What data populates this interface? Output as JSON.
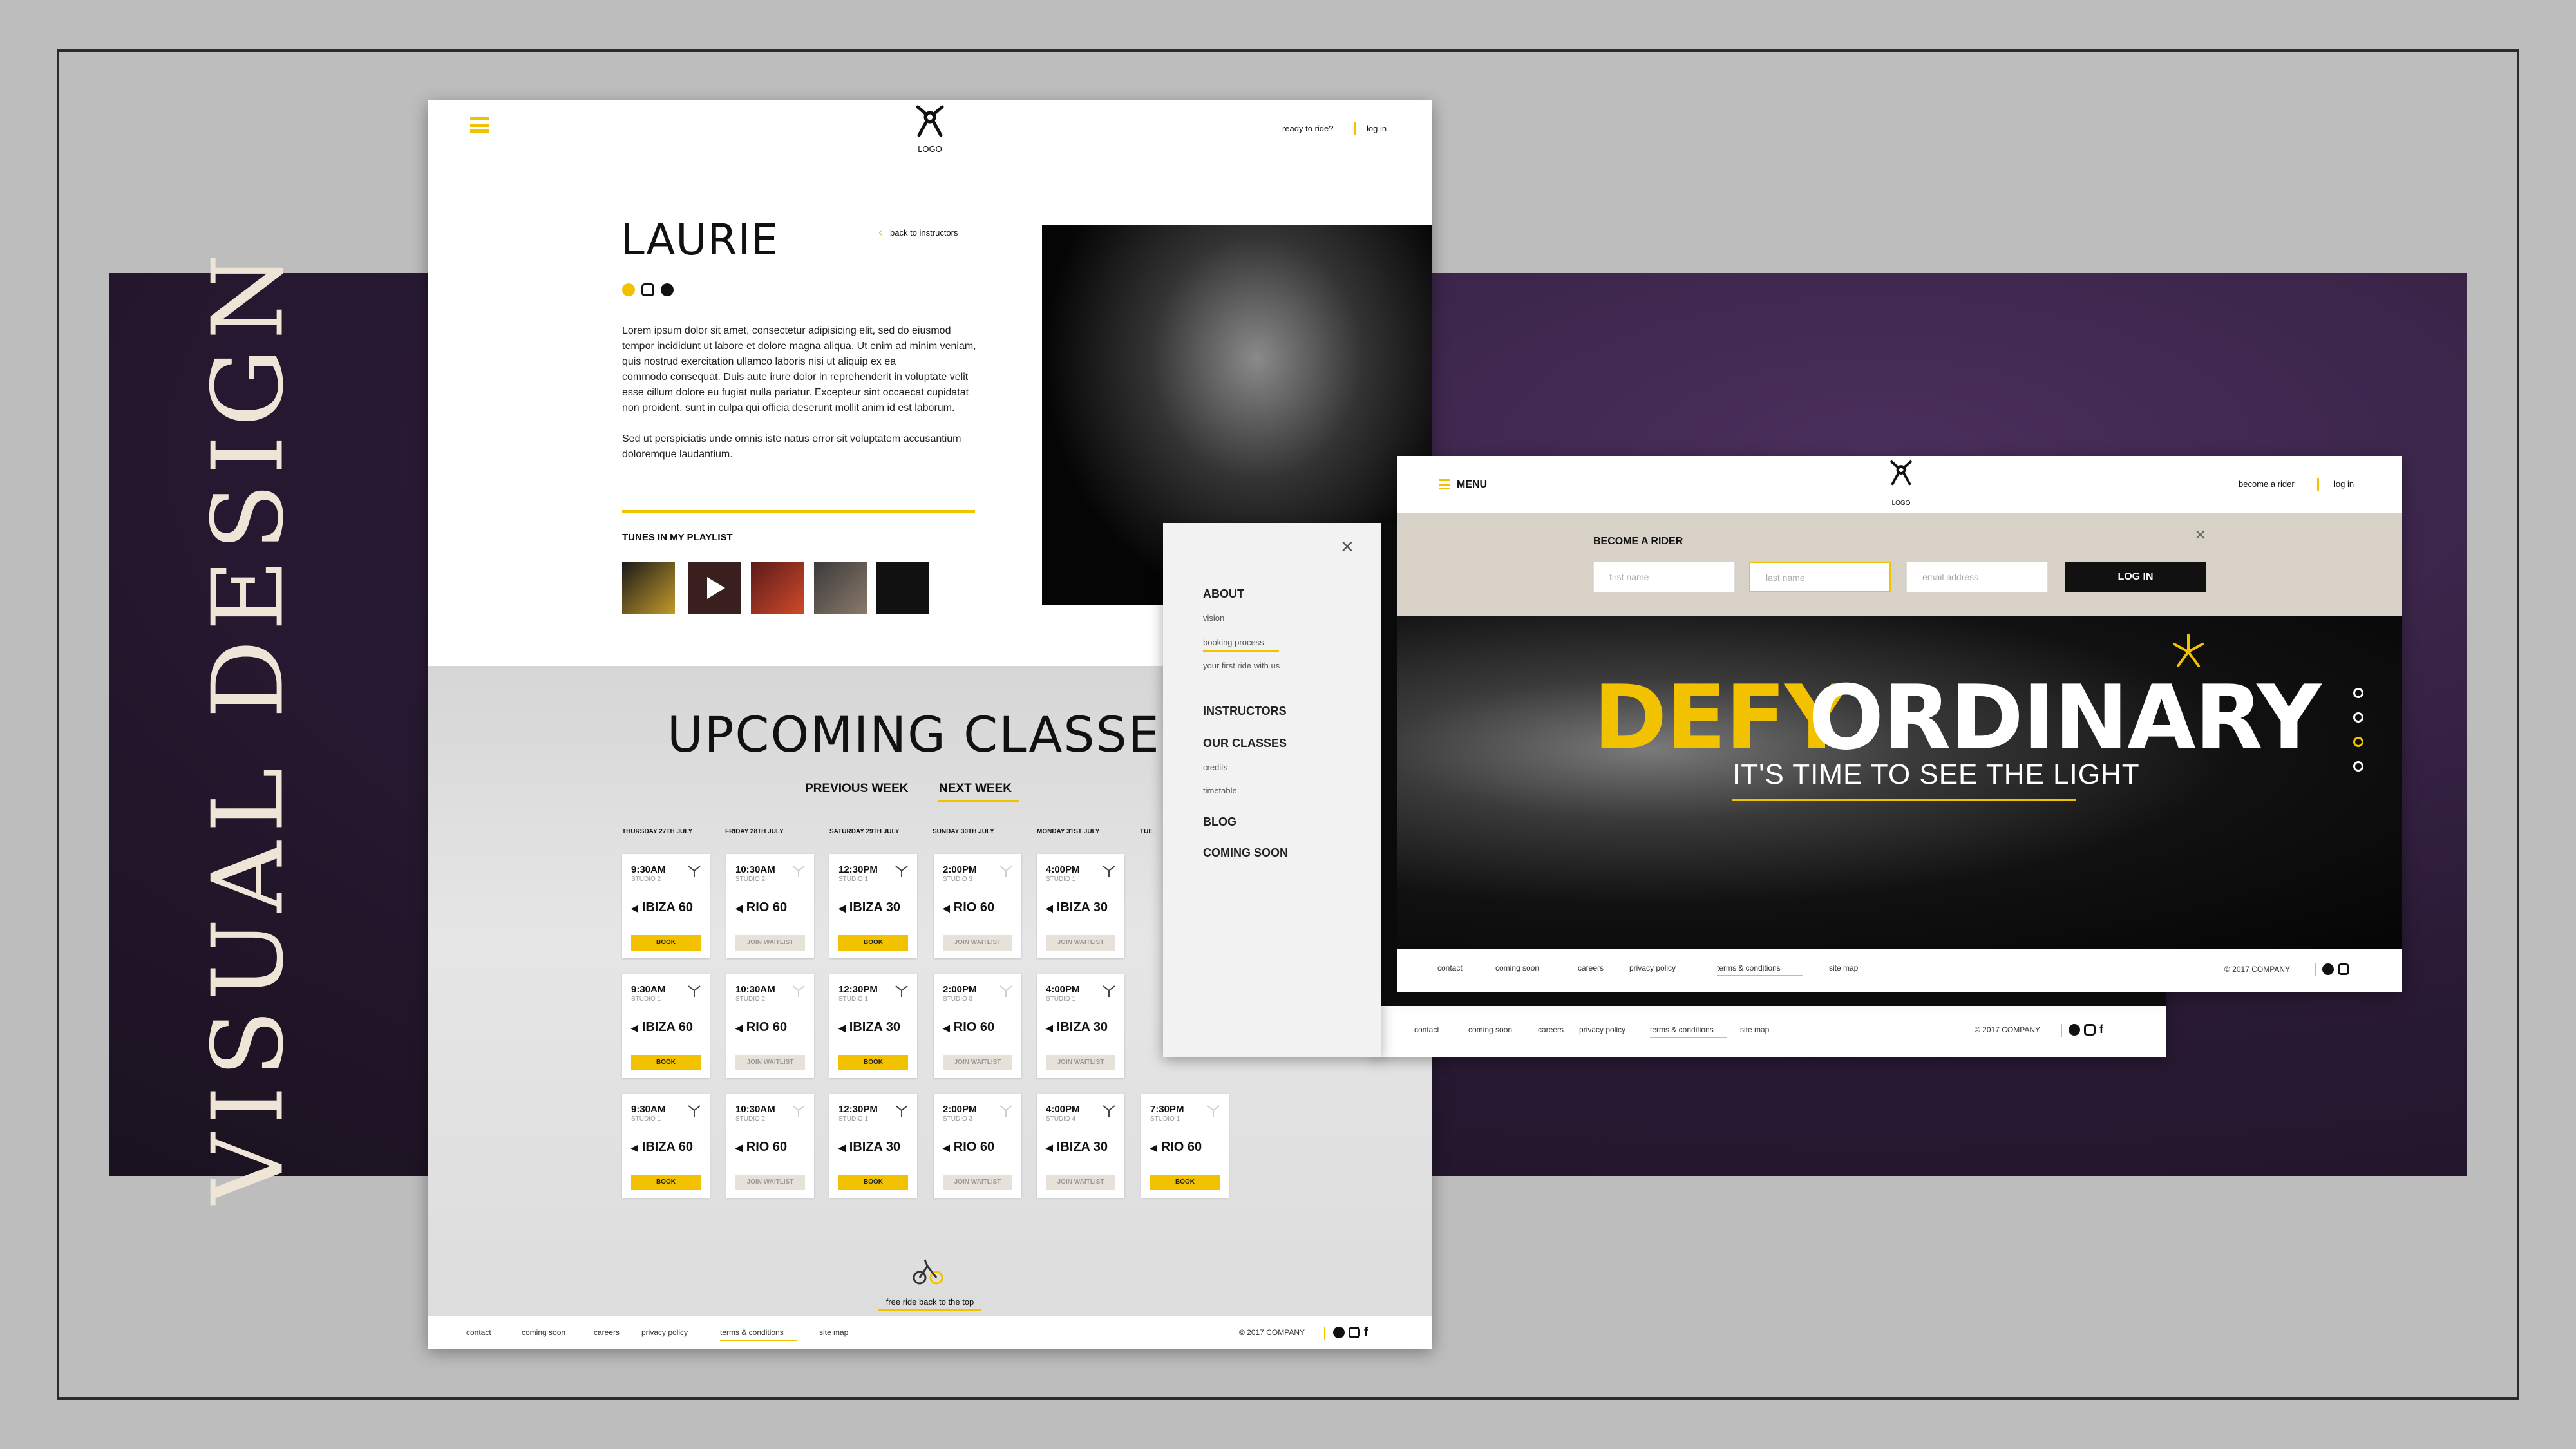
{
  "side_title": "VISUAL DESIGN",
  "colors": {
    "accent": "#f2c200",
    "band": "#2a1a35",
    "dark": "#111111"
  },
  "page1": {
    "logo_text": "LOGO",
    "ready_to_ride": "ready to ride?",
    "log_in": "log in",
    "instructor_name": "LAURIE",
    "back_link": "back to instructors",
    "bio_1": "Lorem ipsum dolor sit amet, consectetur adipisicing elit, sed do eiusmod tempor incididunt ut labore et dolore magna aliqua. Ut enim ad minim veniam, quis nostrud exercitation ullamco laboris nisi ut aliquip ex ea",
    "bio_2": "commodo consequat. Duis aute irure dolor in reprehenderit in voluptate velit esse cillum dolore eu fugiat nulla pariatur. Excepteur sint occaecat cupidatat non proident, sunt in culpa qui officia deserunt mollit anim id est laborum.",
    "bio_3": "Sed ut perspiciatis unde omnis iste natus error sit voluptatem accusantium doloremque laudantium.",
    "playlist_title": "TUNES IN MY PLAYLIST",
    "classes_title": "UPCOMING CLASSES",
    "prev_week": "PREVIOUS WEEK",
    "next_week": "NEXT WEEK",
    "days": [
      "THURSDAY 27TH JULY",
      "FRIDAY 28TH JULY",
      "SATURDAY 29TH JULY",
      "SUNDAY 30TH JULY",
      "MONDAY 31ST JULY",
      "TUE"
    ],
    "back_to_top": "free ride back to the top",
    "footer_links": [
      "contact",
      "coming soon",
      "careers",
      "privacy policy",
      "terms & conditions",
      "site map"
    ],
    "copyright": "© 2017 COMPANY"
  },
  "classes": [
    [
      {
        "time": "9:30AM",
        "studio": "STUDIO 2",
        "name": "IBIZA 60",
        "btn": "BOOK"
      },
      {
        "time": "10:30AM",
        "studio": "STUDIO 2",
        "name": "RIO 60",
        "btn": "JOIN WAITLIST"
      },
      {
        "time": "12:30PM",
        "studio": "STUDIO 1",
        "name": "IBIZA 30",
        "btn": "BOOK"
      },
      {
        "time": "2:00PM",
        "studio": "STUDIO 3",
        "name": "RIO 60",
        "btn": "JOIN WAITLIST"
      },
      {
        "time": "4:00PM",
        "studio": "STUDIO 1",
        "name": "IBIZA 30",
        "btn": "JOIN WAITLIST"
      }
    ],
    [
      {
        "time": "9:30AM",
        "studio": "STUDIO 1",
        "name": "IBIZA 60",
        "btn": "BOOK"
      },
      {
        "time": "10:30AM",
        "studio": "STUDIO 2",
        "name": "RIO 60",
        "btn": "JOIN WAITLIST"
      },
      {
        "time": "12:30PM",
        "studio": "STUDIO 1",
        "name": "IBIZA 30",
        "btn": "BOOK"
      },
      {
        "time": "2:00PM",
        "studio": "STUDIO 3",
        "name": "RIO 60",
        "btn": "JOIN WAITLIST"
      },
      {
        "time": "4:00PM",
        "studio": "STUDIO 1",
        "name": "IBIZA 30",
        "btn": "JOIN WAITLIST"
      }
    ],
    [
      {
        "time": "9:30AM",
        "studio": "STUDIO 1",
        "name": "IBIZA 60",
        "btn": "BOOK"
      },
      {
        "time": "10:30AM",
        "studio": "STUDIO 2",
        "name": "RIO 60",
        "btn": "JOIN WAITLIST"
      },
      {
        "time": "12:30PM",
        "studio": "STUDIO 1",
        "name": "IBIZA 30",
        "btn": "BOOK"
      },
      {
        "time": "2:00PM",
        "studio": "STUDIO 3",
        "name": "RIO 60",
        "btn": "JOIN WAITLIST"
      },
      {
        "time": "4:00PM",
        "studio": "STUDIO 4",
        "name": "IBIZA 30",
        "btn": "JOIN WAITLIST"
      },
      {
        "time": "7:30PM",
        "studio": "STUDIO 1",
        "name": "RIO 60",
        "btn": "BOOK"
      }
    ]
  ],
  "menu": {
    "about": "ABOUT",
    "vision": "vision",
    "booking_process": "booking process",
    "first_ride": "your first ride with us",
    "instructors": "INSTRUCTORS",
    "our_classes": "OUR CLASSES",
    "credits": "credits",
    "timetable": "timetable",
    "blog": "BLOG",
    "coming_soon": "COMING SOON",
    "footer_links": [
      "contact",
      "coming soon",
      "careers",
      "privacy policy",
      "terms & conditions",
      "site map"
    ],
    "copyright": "© 2017 COMPANY"
  },
  "page2": {
    "menu_label": "MENU",
    "logo_text": "LOGO",
    "become_rider": "become a rider",
    "log_in": "log in",
    "form_title": "BECOME A RIDER",
    "first_name": "first name",
    "last_name": "last name",
    "email": "email address",
    "login_button": "LOG IN",
    "headline_1": "DEFY",
    "headline_2": "ORDINARY",
    "subheadline": "IT'S TIME TO SEE THE LIGHT",
    "footer_links": [
      "contact",
      "coming soon",
      "careers",
      "privacy policy",
      "terms & conditions",
      "site map"
    ],
    "copyright": "© 2017 COMPANY"
  }
}
